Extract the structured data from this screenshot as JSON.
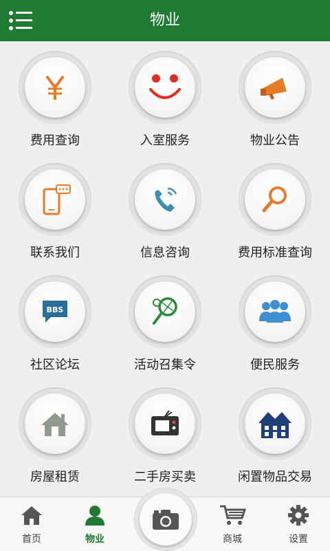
{
  "header": {
    "title": "物业"
  },
  "grid": {
    "items": [
      {
        "label": "费用查询",
        "icon": "yen-icon"
      },
      {
        "label": "入室服务",
        "icon": "smiley-icon"
      },
      {
        "label": "物业公告",
        "icon": "megaphone-icon"
      },
      {
        "label": "联系我们",
        "icon": "phone-message-icon"
      },
      {
        "label": "信息咨询",
        "icon": "telephone-handset-icon"
      },
      {
        "label": "费用标准查询",
        "icon": "magnifier-icon"
      },
      {
        "label": "社区论坛",
        "icon": "bbs-chat-icon"
      },
      {
        "label": "活动召集令",
        "icon": "tennis-racket-icon"
      },
      {
        "label": "便民服务",
        "icon": "people-group-icon"
      },
      {
        "label": "房屋租赁",
        "icon": "house-icon"
      },
      {
        "label": "二手房买卖",
        "icon": "tv-icon"
      },
      {
        "label": "闲置物品交易",
        "icon": "building-icon"
      }
    ]
  },
  "tabbar": {
    "items": [
      {
        "label": "首页",
        "icon": "home-icon"
      },
      {
        "label": "物业",
        "icon": "person-icon"
      },
      {
        "label": "商城",
        "icon": "cart-icon"
      },
      {
        "label": "设置",
        "icon": "gear-icon"
      }
    ],
    "camera_icon": "camera-icon"
  },
  "colors": {
    "brand": "#1f7a33",
    "orange": "#e47b2a",
    "red": "#e52a20",
    "teal": "#3d8fb0",
    "green": "#2d8a3b",
    "blue": "#3f8fd0",
    "navy": "#1d3f7a"
  }
}
